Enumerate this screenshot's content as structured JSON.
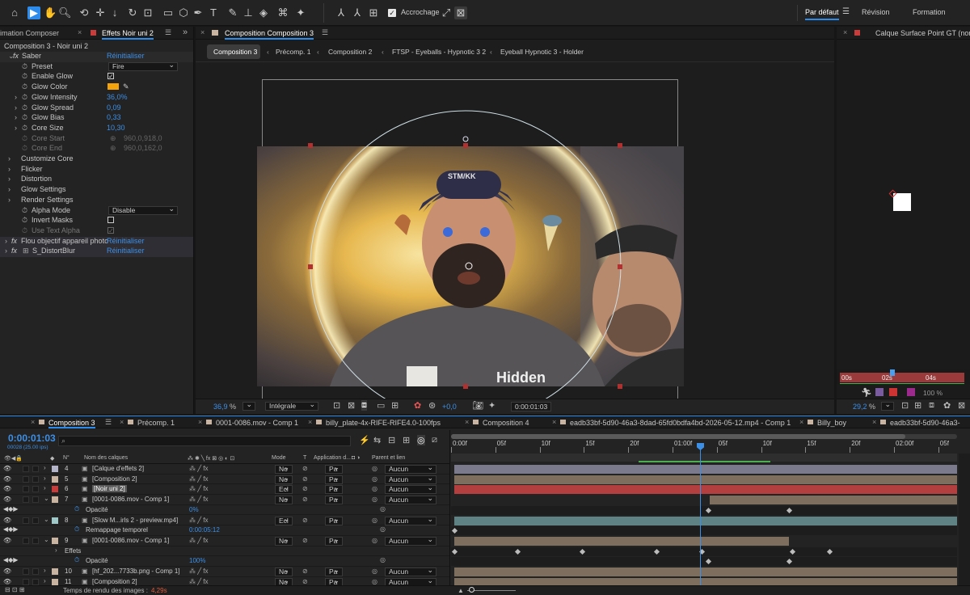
{
  "toolbar": {
    "snap_label": "Accrochage",
    "workspaces": [
      "Par défaut",
      "Révision",
      "Formation"
    ]
  },
  "left_panel": {
    "tab1": "imation Composer",
    "tab2": "Effets Noir uni 2",
    "path": "Composition 3 - Noir uni 2",
    "rows": [
      {
        "indent": 0,
        "label": "Saber",
        "value": "Réinitialiser",
        "fx": true,
        "kind": "link"
      },
      {
        "indent": 1,
        "label": "Preset",
        "value": "Fire",
        "kind": "dropdown"
      },
      {
        "indent": 1,
        "label": "Enable Glow",
        "value": "",
        "kind": "checkbox",
        "checked": true
      },
      {
        "indent": 1,
        "label": "Glow Color",
        "value": "",
        "kind": "color",
        "color": "#f5a30a"
      },
      {
        "indent": 1,
        "label": "Glow Intensity",
        "value": "36,0%",
        "kind": "num",
        "arrow": true
      },
      {
        "indent": 1,
        "label": "Glow Spread",
        "value": "0,09",
        "kind": "num",
        "arrow": true
      },
      {
        "indent": 1,
        "label": "Glow Bias",
        "value": "0,33",
        "kind": "num",
        "arrow": true
      },
      {
        "indent": 1,
        "label": "Core Size",
        "value": "10,30",
        "kind": "num",
        "arrow": true
      },
      {
        "indent": 1,
        "label": "Core Start",
        "value": "960,0,918,0",
        "kind": "dim"
      },
      {
        "indent": 1,
        "label": "Core End",
        "value": "960,0,162,0",
        "kind": "dim"
      },
      {
        "indent": 0,
        "label": "Customize Core",
        "value": "",
        "kind": "group"
      },
      {
        "indent": 0,
        "label": "Flicker",
        "value": "",
        "kind": "group"
      },
      {
        "indent": 0,
        "label": "Distortion",
        "value": "",
        "kind": "group"
      },
      {
        "indent": 0,
        "label": "Glow Settings",
        "value": "",
        "kind": "group"
      },
      {
        "indent": 0,
        "label": "Render Settings",
        "value": "",
        "kind": "group"
      },
      {
        "indent": 1,
        "label": "Alpha Mode",
        "value": "Disable",
        "kind": "dropdown"
      },
      {
        "indent": 1,
        "label": "Invert Masks",
        "value": "",
        "kind": "checkbox",
        "checked": false
      },
      {
        "indent": 1,
        "label": "Use Text Alpha",
        "value": "",
        "kind": "checkbox-dim",
        "checked": true
      },
      {
        "indent": -1,
        "label": "Flou objectif appareil photo",
        "value": "Réinitialiser",
        "fx": true,
        "kind": "link"
      },
      {
        "indent": -1,
        "label": "S_DistortBlur",
        "value": "Réinitialiser",
        "fx": true,
        "kind": "link"
      }
    ]
  },
  "comp_panel": {
    "tab": "Composition Composition 3",
    "crumbs": [
      "Composition 3",
      "Précomp. 1",
      "Composition 2",
      "FTSP - Eyeballs - Hypnotic 3 2",
      "Eyeball Hypnotic 3 - Holder"
    ],
    "zoom": "36,9",
    "zoom_unit": "%",
    "quality": "Intégrale",
    "exposure": "+0,0",
    "timecode": "0:00:01:03",
    "image_text": {
      "cap": "STM/KK",
      "shirt": "Hidden"
    }
  },
  "right_panel": {
    "tab": "Calque Surface Point GT (norma",
    "ruler": [
      "00s",
      "02s",
      "04s"
    ],
    "zoom": "29,2",
    "zoom_unit": "%",
    "pct": "100 %"
  },
  "timeline": {
    "tabs": [
      "Composition 3",
      "Précomp. 1",
      "0001-0086.mov - Comp 1",
      "billy_plate-4x-RIFE-RIFE4.0-100fps",
      "Composition 4",
      "eadb33bf-5d90-46a3-8dad-65fd0bdfa4bd-2026-05-12.mp4 - Comp 1",
      "Billy_boy",
      "eadb33bf-5d90-46a3-"
    ],
    "timecode": "0:00:01:03",
    "frame_info": "00028 (25.00 ips)",
    "headers": {
      "name": "Nom des calques",
      "num": "N°",
      "mode": "Mode",
      "t": "T",
      "app": "Application d...",
      "parent": "Parent et lien"
    },
    "ruler": [
      "0:00f",
      "05f",
      "10f",
      "15f",
      "20f",
      "01:00f",
      "05f",
      "10f",
      "15f",
      "20f",
      "02:00f",
      "05f"
    ],
    "rows": [
      {
        "num": "4",
        "name": "[Calque d'effets 2]",
        "mode": "No",
        "app": "Pa",
        "parent": "Aucun",
        "color": "#b4b4c8",
        "kind": "layer",
        "bar": "#7a7a8c"
      },
      {
        "num": "5",
        "name": "[Composition 2]",
        "mode": "No",
        "app": "Pa",
        "parent": "Aucun",
        "color": "#c8b4a0",
        "kind": "layer",
        "bar": "#7d6e5d"
      },
      {
        "num": "6",
        "name": "[Noir uni 2]",
        "mode": "Ecl",
        "app": "Pa",
        "parent": "Aucun",
        "color": "#c83c3c",
        "kind": "layer",
        "bar": "#b3403e",
        "selected": true
      },
      {
        "num": "7",
        "name": "[0001-0086.mov - Comp 1]",
        "mode": "No",
        "app": "Pa",
        "parent": "Aucun",
        "color": "#c8b4a0",
        "kind": "layer",
        "bar": "#7d6e5d"
      },
      {
        "name": "Opacité",
        "value": "0%",
        "kind": "prop"
      },
      {
        "num": "8",
        "name": "[Slow M...irls 2 - preview.mp4]",
        "mode": "Ecl",
        "app": "Pa",
        "parent": "Aucun",
        "color": "#a0c8c8",
        "kind": "layer",
        "bar": "#5f8284"
      },
      {
        "name": "Remappage temporel",
        "value": "0:00:05:12",
        "kind": "prop"
      },
      {
        "num": "9",
        "name": "[0001-0086.mov - Comp 1]",
        "mode": "No",
        "app": "Pa",
        "parent": "Aucun",
        "color": "#c8b4a0",
        "kind": "layer",
        "bar": "#7d6e5d"
      },
      {
        "name": "Effets",
        "value": "",
        "kind": "group"
      },
      {
        "name": "Opacité",
        "value": "100%",
        "kind": "prop"
      },
      {
        "num": "10",
        "name": "[hf_202...7733b.png - Comp 1]",
        "mode": "No",
        "app": "Pa",
        "parent": "Aucun",
        "color": "#c8b4a0",
        "kind": "layer",
        "bar": "#7d6e5d"
      },
      {
        "num": "11",
        "name": "[Composition 2]",
        "mode": "No",
        "app": "Pa",
        "parent": "Aucun",
        "color": "#c8b4a0",
        "kind": "layer",
        "bar": "#7d6e5d"
      }
    ],
    "render_label": "Temps de rendu des images :",
    "render_value": "4,29s"
  }
}
